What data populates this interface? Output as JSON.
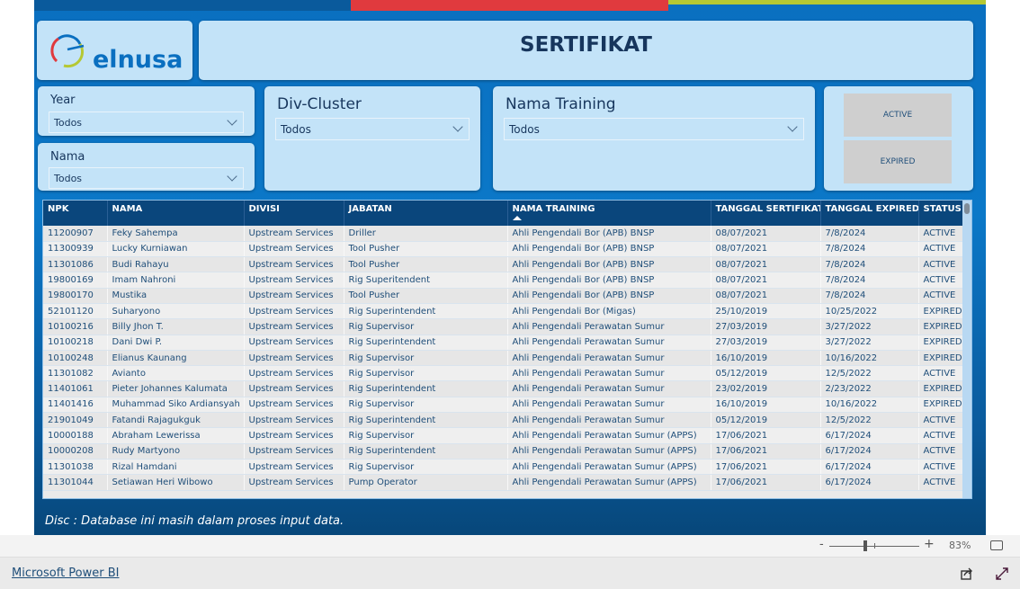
{
  "header": {
    "logo_text": "elnusa",
    "title": "SERTIFIKAT"
  },
  "colors": {
    "brand_blue": "#0a6fc0",
    "header_navy": "#0a467c",
    "accent_red": "#e03a3e",
    "accent_green": "#b5c834"
  },
  "slicers": {
    "year": {
      "label": "Year",
      "value": "Todos"
    },
    "nama": {
      "label": "Nama",
      "value": "Todos"
    },
    "div_cluster": {
      "label": "Div-Cluster",
      "value": "Todos"
    },
    "nama_training": {
      "label": "Nama Training",
      "value": "Todos"
    }
  },
  "status_buttons": {
    "active": "ACTIVE",
    "expired": "EXPIRED"
  },
  "table": {
    "columns": [
      "NPK",
      "NAMA",
      "DIVISI",
      "JABATAN",
      "NAMA TRAINING",
      "TANGGAL SERTIFIKAT",
      "TANGGAL EXPIRED",
      "STATUS"
    ],
    "sorted_column": "NAMA TRAINING",
    "rows": [
      [
        "11200907",
        "Feky Sahempa",
        "Upstream Services",
        "Driller",
        "Ahli Pengendali Bor (APB) BNSP",
        "08/07/2021",
        "7/8/2024",
        "ACTIVE"
      ],
      [
        "11300939",
        "Lucky Kurniawan",
        "Upstream Services",
        "Tool Pusher",
        "Ahli Pengendali Bor (APB) BNSP",
        "08/07/2021",
        "7/8/2024",
        "ACTIVE"
      ],
      [
        "11301086",
        "Budi Rahayu",
        "Upstream Services",
        "Tool Pusher",
        "Ahli Pengendali Bor (APB) BNSP",
        "08/07/2021",
        "7/8/2024",
        "ACTIVE"
      ],
      [
        "19800169",
        "Imam Nahroni",
        "Upstream Services",
        "Rig Superitendent",
        "Ahli Pengendali Bor (APB) BNSP",
        "08/07/2021",
        "7/8/2024",
        "ACTIVE"
      ],
      [
        "19800170",
        "Mustika",
        "Upstream Services",
        "Tool Pusher",
        "Ahli Pengendali Bor (APB) BNSP",
        "08/07/2021",
        "7/8/2024",
        "ACTIVE"
      ],
      [
        "52101120",
        "Suharyono",
        "Upstream Services",
        "Rig Superintendent",
        "Ahli Pengendali Bor (Migas)",
        "25/10/2019",
        "10/25/2022",
        "EXPIRED"
      ],
      [
        "10100216",
        "Billy Jhon T.",
        "Upstream Services",
        "Rig Supervisor",
        "Ahli Pengendali Perawatan Sumur",
        "27/03/2019",
        "3/27/2022",
        "EXPIRED"
      ],
      [
        "10100218",
        "Dani Dwi P.",
        "Upstream Services",
        "Rig Superintendent",
        "Ahli Pengendali Perawatan Sumur",
        "27/03/2019",
        "3/27/2022",
        "EXPIRED"
      ],
      [
        "10100248",
        "Elianus Kaunang",
        "Upstream Services",
        "Rig Supervisor",
        "Ahli Pengendali Perawatan Sumur",
        "16/10/2019",
        "10/16/2022",
        "EXPIRED"
      ],
      [
        "11301082",
        "Avianto",
        "Upstream Services",
        "Rig Supervisor",
        "Ahli Pengendali Perawatan Sumur",
        "05/12/2019",
        "12/5/2022",
        "ACTIVE"
      ],
      [
        "11401061",
        "Pieter Johannes Kalumata",
        "Upstream Services",
        "Rig Superintendent",
        "Ahli Pengendali Perawatan Sumur",
        "23/02/2019",
        "2/23/2022",
        "EXPIRED"
      ],
      [
        "11401416",
        "Muhammad Siko Ardiansyah",
        "Upstream Services",
        "Rig Supervisor",
        "Ahli Pengendali Perawatan Sumur",
        "16/10/2019",
        "10/16/2022",
        "EXPIRED"
      ],
      [
        "21901049",
        "Fatandi Rajagukguk",
        "Upstream Services",
        "Rig Superintendent",
        "Ahli Pengendali Perawatan Sumur",
        "05/12/2019",
        "12/5/2022",
        "ACTIVE"
      ],
      [
        "10000188",
        "Abraham Lewerissa",
        "Upstream Services",
        "Rig Supervisor",
        "Ahli Pengendali Perawatan Sumur (APPS)",
        "17/06/2021",
        "6/17/2024",
        "ACTIVE"
      ],
      [
        "10000208",
        "Rudy Martyono",
        "Upstream Services",
        "Rig Superintendent",
        "Ahli Pengendali Perawatan Sumur (APPS)",
        "17/06/2021",
        "6/17/2024",
        "ACTIVE"
      ],
      [
        "11301038",
        "Rizal Hamdani",
        "Upstream Services",
        "Rig Supervisor",
        "Ahli Pengendali Perawatan Sumur (APPS)",
        "17/06/2021",
        "6/17/2024",
        "ACTIVE"
      ],
      [
        "11301044",
        "Setiawan Heri Wibowo",
        "Upstream Services",
        "Pump Operator",
        "Ahli Pengendali Perawatan Sumur (APPS)",
        "17/06/2021",
        "6/17/2024",
        "ACTIVE"
      ]
    ]
  },
  "disclaimer": "Disc : Database ini masih dalam proses input data.",
  "zoom": {
    "minus": "-",
    "plus": "+",
    "level": "83%",
    "level_value": 83
  },
  "footer": {
    "link": "Microsoft Power BI"
  }
}
